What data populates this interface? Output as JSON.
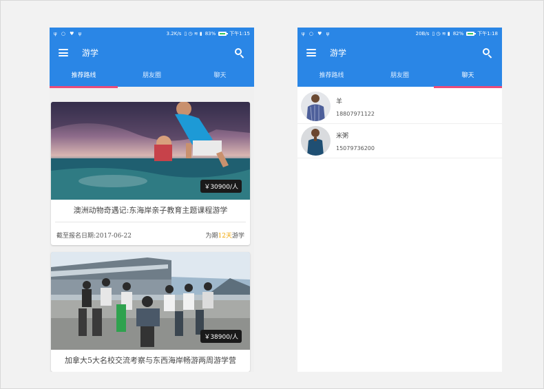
{
  "statusbar_left": {
    "time": "下午1:15",
    "speed": "3.2K/s",
    "battery": "83%",
    "battery_level": 0.83
  },
  "statusbar_right": {
    "time": "下午1:18",
    "speed": "20B/s",
    "battery": "82%",
    "battery_level": 0.82
  },
  "app": {
    "title": "游学"
  },
  "tabs": [
    {
      "label": "推荐路线"
    },
    {
      "label": "朋友圈"
    },
    {
      "label": "聊天"
    }
  ],
  "left_active_tab": 0,
  "right_active_tab": 2,
  "cards": [
    {
      "price": "￥30900/人",
      "title": "澳洲动物奇遇记:东海岸亲子教育主题课程游学",
      "deadline": "截至报名日期:2017-06-22",
      "duration_prefix": "为期",
      "duration_days": "12天",
      "duration_suffix": "游学"
    },
    {
      "price": "￥38900/人",
      "title": "加拿大5大名校交流考察与东西海岸畅游两周游学营"
    }
  ],
  "contacts": [
    {
      "name": "羊",
      "phone": "18807971122"
    },
    {
      "name": "米粥",
      "phone": "15079736200"
    }
  ],
  "colors": {
    "primary": "#2a86e6",
    "tab_indicator": "#ea4c7a",
    "days_highlight": "#f0a400"
  },
  "icons": [
    "menu-icon",
    "search-icon"
  ]
}
